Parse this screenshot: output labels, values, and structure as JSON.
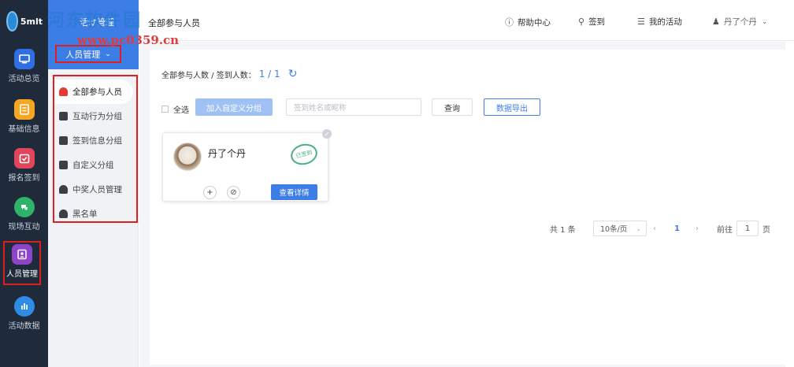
{
  "rail": {
    "logo_text": "5mlt",
    "items": [
      {
        "label": "活动总览",
        "icon": "monitor-icon",
        "color": "#2f6fe3"
      },
      {
        "label": "基础信息",
        "icon": "document-icon",
        "color": "#f5a623"
      },
      {
        "label": "报名签到",
        "icon": "checkin-icon",
        "color": "#e0455b"
      },
      {
        "label": "现场互动",
        "icon": "interaction-icon",
        "color": "#2fb36a"
      },
      {
        "label": "人员管理",
        "icon": "person-card-icon",
        "color": "#8e44c9"
      },
      {
        "label": "活动数据",
        "icon": "bar-chart-icon",
        "color": "#2f8be3"
      }
    ]
  },
  "sub": {
    "title": "活动管理",
    "dropdown_label": "人员管理",
    "items": [
      {
        "label": "全部参与人员",
        "icon": "person-icon",
        "active": true
      },
      {
        "label": "互动行为分组",
        "icon": "chat-icon"
      },
      {
        "label": "签到信息分组",
        "icon": "checkbox-icon"
      },
      {
        "label": "自定义分组",
        "icon": "edit-icon"
      },
      {
        "label": "中奖人员管理",
        "icon": "user-gear-icon"
      },
      {
        "label": "黑名单",
        "icon": "user-block-icon"
      }
    ]
  },
  "header": {
    "title": "全部参与人员",
    "help": "帮助中心",
    "signin": "签到",
    "my_activities": "我的活动",
    "user": "丹了个丹"
  },
  "main": {
    "count_label": "全部参与人数 / 签到人数：",
    "count_value": "1 / 1",
    "select_all": "全选",
    "add_group_button": "加入自定义分组",
    "search_placeholder": "签到姓名或昵称",
    "query_button": "查询",
    "export_button": "数据导出",
    "card": {
      "name": "丹了个丹",
      "stamp": "已签到",
      "detail_button": "查看详情"
    },
    "pager": {
      "total": "共 1 条",
      "page_size": "10条/页",
      "current_page": "1",
      "goto_label": "前往",
      "goto_value": "1",
      "page_unit": "页"
    }
  },
  "watermark": {
    "text": "河东软件园",
    "url": "www.pc0359.cn"
  }
}
